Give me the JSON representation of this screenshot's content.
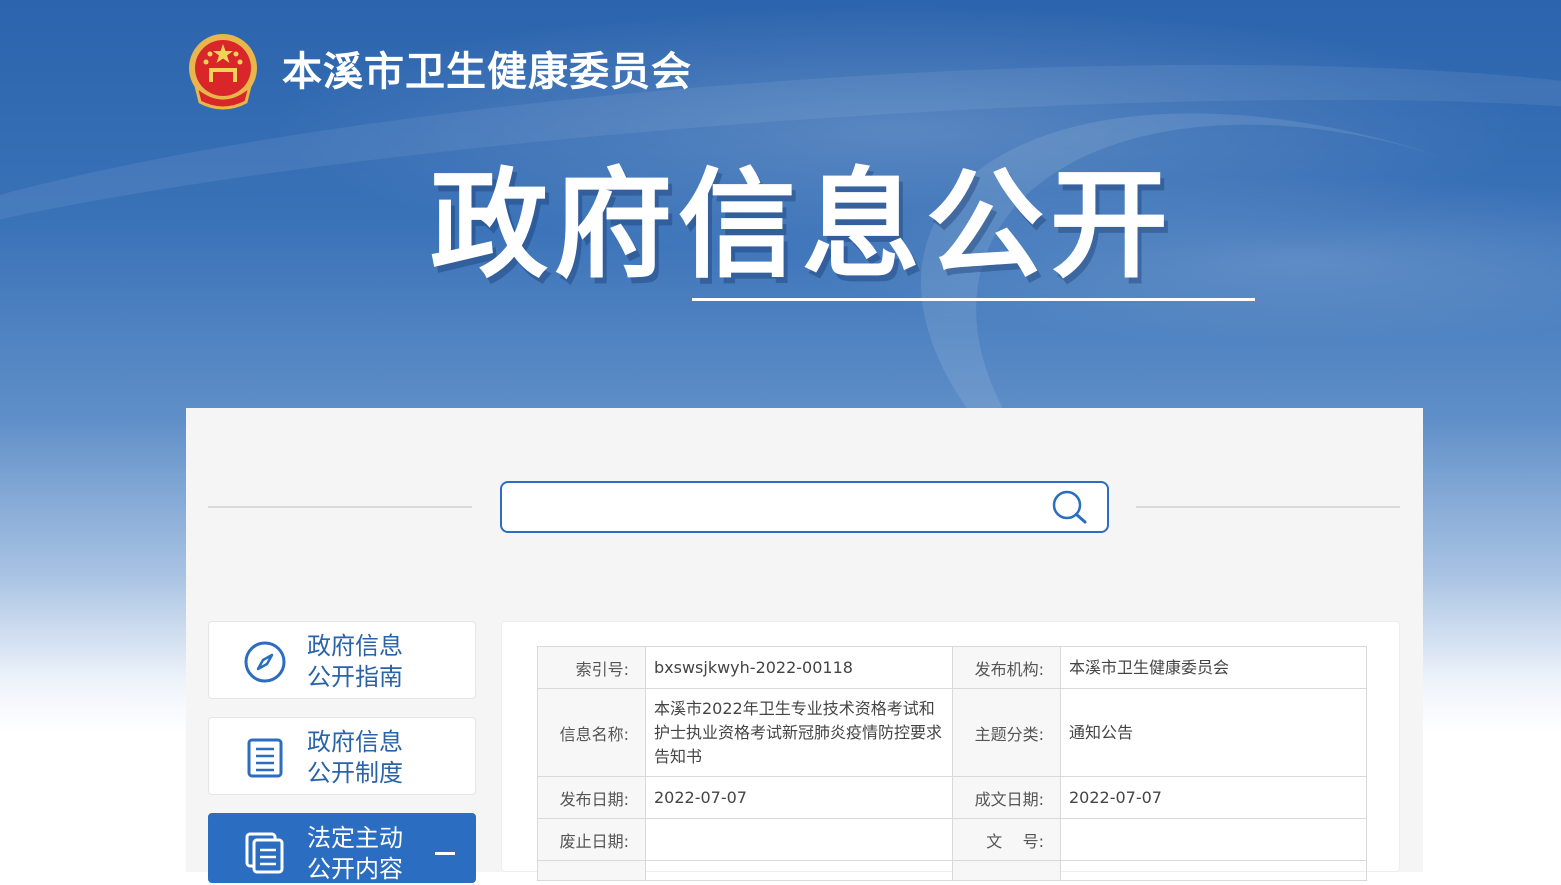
{
  "site": {
    "title": "本溪市卫生健康委员会",
    "emblem": "national-emblem-icon"
  },
  "hero": {
    "title": "政府信息公开"
  },
  "search": {
    "placeholder": "",
    "icon": "search-icon"
  },
  "sidebar": {
    "items": [
      {
        "label_line1": "政府信息",
        "label_line2": "公开指南",
        "icon": "compass-icon",
        "active": false
      },
      {
        "label_line1": "政府信息",
        "label_line2": "公开制度",
        "icon": "list-document-icon",
        "active": false
      },
      {
        "label_line1": "法定主动",
        "label_line2": "公开内容",
        "icon": "stacked-document-icon",
        "active": true
      }
    ]
  },
  "meta": {
    "index_key": "索引号:",
    "index_value": "bxswsjkwyh-2022-00118",
    "publisher_key": "发布机构:",
    "publisher_value": "本溪市卫生健康委员会",
    "name_key": "信息名称:",
    "name_value": "本溪市2022年卫生专业技术资格考试和护士执业资格考试新冠肺炎疫情防控要求告知书",
    "category_key": "主题分类:",
    "category_value": "通知公告",
    "publish_date_key": "发布日期:",
    "publish_date_value": "2022-07-07",
    "created_date_key": "成文日期:",
    "created_date_value": "2022-07-07",
    "expire_date_key": "废止日期:",
    "expire_date_value": "",
    "doc_no_key": "文    号:",
    "doc_no_value": ""
  },
  "colors": {
    "accent": "#2b6dc0",
    "hero_blue": "#2c64ad"
  }
}
